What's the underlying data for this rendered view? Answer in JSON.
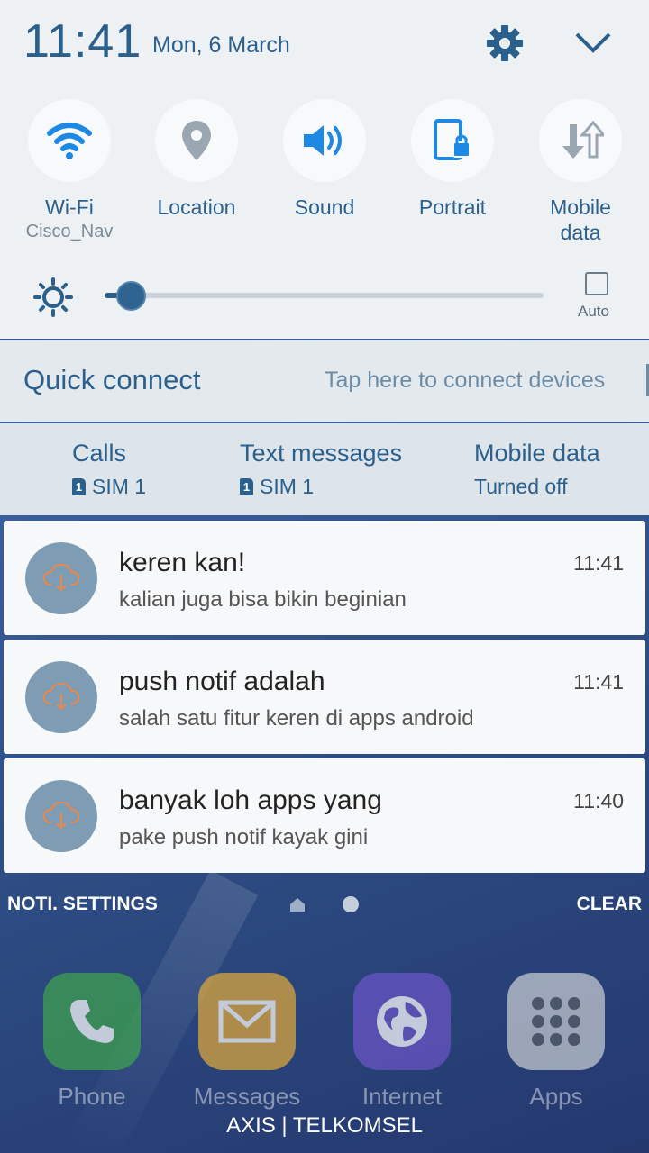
{
  "status": {
    "time": "11:41",
    "date": "Mon, 6 March"
  },
  "quick_settings": [
    {
      "label": "Wi-Fi",
      "sub": "Cisco_Nav",
      "icon": "wifi-icon"
    },
    {
      "label": "Location",
      "sub": "",
      "icon": "location-icon"
    },
    {
      "label": "Sound",
      "sub": "",
      "icon": "sound-icon"
    },
    {
      "label": "Portrait",
      "sub": "",
      "icon": "portrait-lock-icon"
    },
    {
      "label": "Mobile\ndata",
      "sub": "",
      "icon": "mobile-data-icon"
    }
  ],
  "brightness": {
    "level": 0.06,
    "auto_label": "Auto"
  },
  "quick_connect": {
    "title": "Quick connect",
    "hint": "Tap here to connect devices"
  },
  "sim": [
    {
      "title": "Calls",
      "badge": "1",
      "value": "SIM 1"
    },
    {
      "title": "Text messages",
      "badge": "1",
      "value": "SIM 1"
    },
    {
      "title": "Mobile data",
      "badge": "",
      "value": "Turned off"
    }
  ],
  "notifications": [
    {
      "title": "keren kan!",
      "body": "kalian juga bisa bikin beginian",
      "time": "11:41"
    },
    {
      "title": "push notif adalah",
      "body": "salah satu fitur keren di apps android",
      "time": "11:41"
    },
    {
      "title": "banyak loh apps yang",
      "body": "pake push notif kayak gini",
      "time": "11:40"
    }
  ],
  "actions": {
    "settings": "NOTI. SETTINGS",
    "clear": "CLEAR"
  },
  "dock": [
    {
      "label": "Phone",
      "icon": "phone-icon"
    },
    {
      "label": "Messages",
      "icon": "messages-icon"
    },
    {
      "label": "Internet",
      "icon": "globe-icon"
    },
    {
      "label": "Apps",
      "icon": "apps-grid-icon"
    }
  ],
  "carrier": "AXIS | TELKOMSEL",
  "colors": {
    "accent": "#2b5f8c",
    "panel": "#eef1f4",
    "notif_avatar": "#7f9cb5",
    "notif_icon": "#e8894a"
  }
}
